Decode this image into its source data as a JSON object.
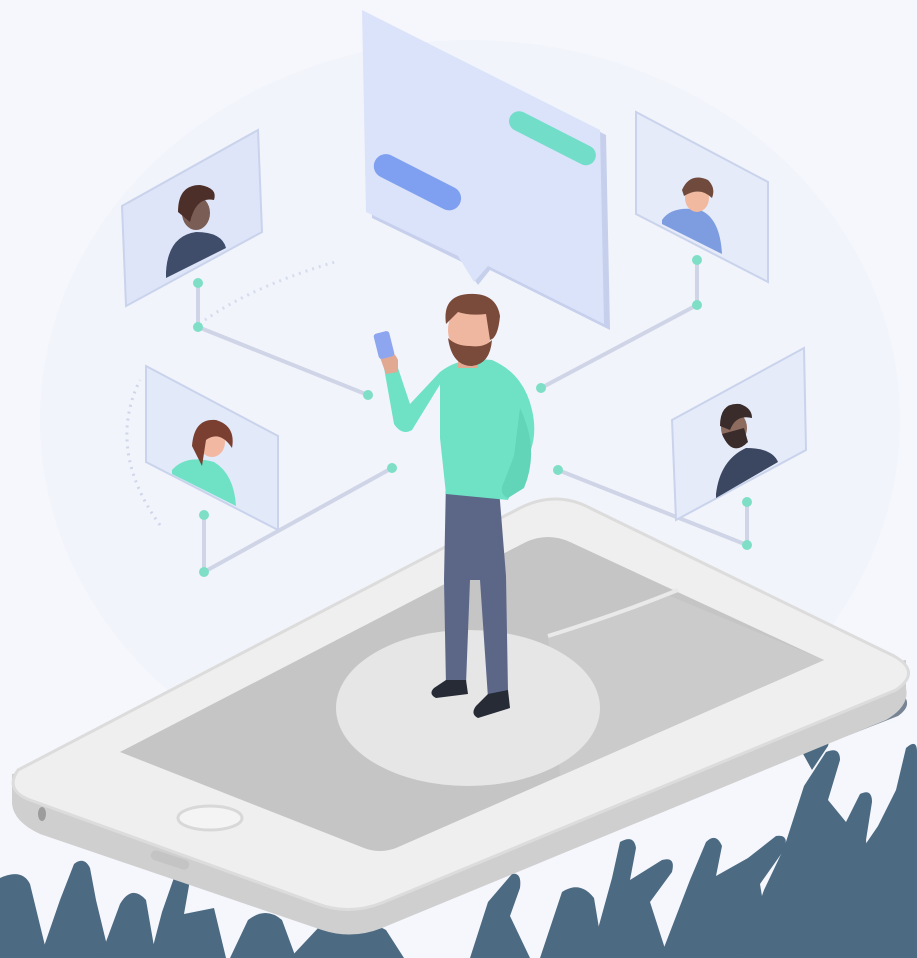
{
  "scene": {
    "subject": "isometric-social-network-illustration",
    "colors": {
      "background": "#f6f7fc",
      "panel_fill": "#d9e2f8",
      "panel_edge": "#c2cdea",
      "accent_teal": "#68e0c3",
      "accent_blue": "#7b9cf0",
      "person_pants": "#5a6587",
      "person_shirt": "#6fe2c6",
      "hair_brown": "#7a4a3a",
      "phone_body": "#ececec",
      "phone_screen": "#c6c6c6",
      "crowd": "#4c6a82",
      "connector": "#8fe3cd"
    },
    "icons": [
      "chat-bubble-icon",
      "profile-card-icon",
      "smartphone-icon",
      "crowd-silhouette-icon",
      "connector-dot-icon"
    ]
  }
}
